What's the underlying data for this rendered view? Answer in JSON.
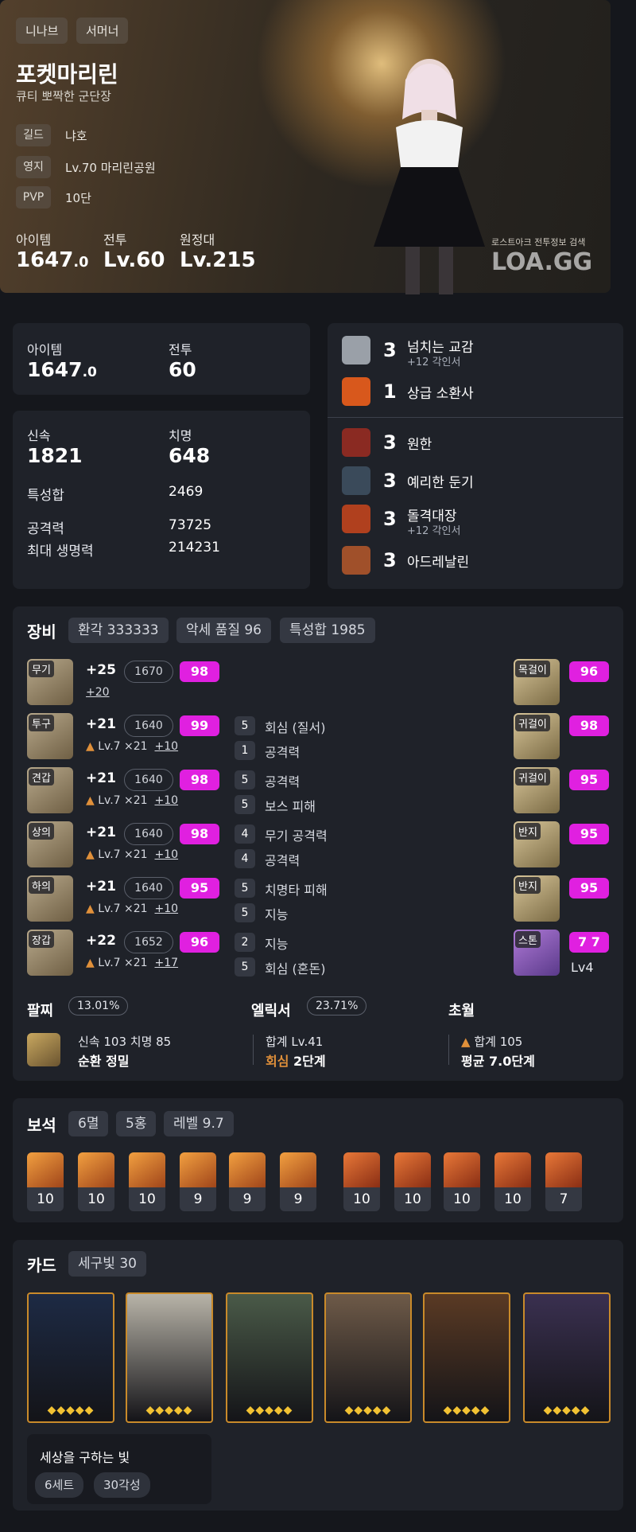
{
  "hero": {
    "server": "니나브",
    "class": "서머너",
    "name": "포켓마리린",
    "title": "큐티 뽀짝한 군단장",
    "rows": [
      {
        "label": "길드",
        "value": "냐호"
      },
      {
        "label": "영지",
        "value": "Lv.70 마리린공원"
      },
      {
        "label": "PVP",
        "value": "10단"
      }
    ],
    "stats": [
      {
        "label": "아이템",
        "main": "1647",
        "small": ".0"
      },
      {
        "label": "전투",
        "main": "Lv.60",
        "small": ""
      },
      {
        "label": "원정대",
        "main": "Lv.215",
        "small": ""
      }
    ],
    "watermark_small": "로스트아크 전투정보 검색",
    "watermark_big": "LOA.GG"
  },
  "summary": {
    "item_label": "아이템",
    "item_main": "1647",
    "item_small": ".0",
    "combat_label": "전투",
    "combat_value": "60"
  },
  "stats": {
    "speed_label": "신속",
    "speed_value": "1821",
    "crit_label": "치명",
    "crit_value": "648",
    "total_label": "특성합",
    "total_value": "2469",
    "atk_label": "공격력",
    "atk_value": "73725",
    "hp_label": "최대 생명력",
    "hp_value": "214231"
  },
  "engravings_top": [
    {
      "level": "3",
      "name": "넘치는 교감",
      "sub": "+12 각인서",
      "icon_color": "#9aa0a8"
    },
    {
      "level": "1",
      "name": "상급 소환사",
      "sub": "",
      "icon_color": "#d8581c"
    }
  ],
  "engravings_bottom": [
    {
      "level": "3",
      "name": "원한",
      "sub": "",
      "icon_color": "#8a2a22"
    },
    {
      "level": "3",
      "name": "예리한 둔기",
      "sub": "",
      "icon_color": "#3a4a5a"
    },
    {
      "level": "3",
      "name": "돌격대장",
      "sub": "+12 각인서",
      "icon_color": "#b0401e"
    },
    {
      "level": "3",
      "name": "아드레날린",
      "sub": "",
      "icon_color": "#a0502a"
    }
  ],
  "equipment": {
    "title": "장비",
    "pills": [
      "환각 333333",
      "악세 품질 96",
      "특성합 1985"
    ],
    "gear": [
      {
        "tag": "무기",
        "plus": "+25",
        "level": "1670",
        "quality": "98",
        "sub_plain": "",
        "sub_link": "+20",
        "opts": []
      },
      {
        "tag": "투구",
        "plus": "+21",
        "level": "1640",
        "quality": "99",
        "sub_plain": "Lv.7 ×21",
        "sub_link": "+10",
        "opts": [
          {
            "n": "5",
            "t": "회심 (질서)"
          },
          {
            "n": "1",
            "t": "공격력"
          }
        ]
      },
      {
        "tag": "견갑",
        "plus": "+21",
        "level": "1640",
        "quality": "98",
        "sub_plain": "Lv.7 ×21",
        "sub_link": "+10",
        "opts": [
          {
            "n": "5",
            "t": "공격력"
          },
          {
            "n": "5",
            "t": "보스 피해"
          }
        ]
      },
      {
        "tag": "상의",
        "plus": "+21",
        "level": "1640",
        "quality": "98",
        "sub_plain": "Lv.7 ×21",
        "sub_link": "+10",
        "opts": [
          {
            "n": "4",
            "t": "무기 공격력"
          },
          {
            "n": "4",
            "t": "공격력"
          }
        ]
      },
      {
        "tag": "하의",
        "plus": "+21",
        "level": "1640",
        "quality": "95",
        "sub_plain": "Lv.7 ×21",
        "sub_link": "+10",
        "opts": [
          {
            "n": "5",
            "t": "치명타 피해"
          },
          {
            "n": "5",
            "t": "지능"
          }
        ]
      },
      {
        "tag": "장갑",
        "plus": "+22",
        "level": "1652",
        "quality": "96",
        "sub_plain": "Lv.7 ×21",
        "sub_link": "+17",
        "opts": [
          {
            "n": "2",
            "t": "지능"
          },
          {
            "n": "5",
            "t": "회심 (혼돈)"
          }
        ]
      }
    ],
    "accessories": [
      {
        "tag": "목걸이",
        "quality": "96"
      },
      {
        "tag": "귀걸이",
        "quality": "98"
      },
      {
        "tag": "귀걸이",
        "quality": "95"
      },
      {
        "tag": "반지",
        "quality": "95"
      },
      {
        "tag": "반지",
        "quality": "95"
      },
      {
        "tag": "스톤",
        "quality": "7 7",
        "sub": "Lv4"
      }
    ],
    "bracelet": {
      "title": "팔찌",
      "pct": "13.01%",
      "line1": "신속 103   치명 85",
      "line2": "순환   정밀"
    },
    "elixir": {
      "title": "엘릭서",
      "pct": "23.71%",
      "line1": "합계 Lv.41",
      "line2_a": "회심",
      "line2_b": "2단계"
    },
    "transcend": {
      "title": "초월",
      "line1": "합계 105",
      "line2": "평균 7.0단계"
    }
  },
  "gems": {
    "title": "보석",
    "pills": [
      "6멸",
      "5홍",
      "레벨 9.7"
    ],
    "items": [
      {
        "type": "a",
        "level": "10"
      },
      {
        "type": "a",
        "level": "10"
      },
      {
        "type": "a",
        "level": "10"
      },
      {
        "type": "a",
        "level": "9"
      },
      {
        "type": "a",
        "level": "9"
      },
      {
        "type": "a",
        "level": "9"
      },
      {
        "type": "b",
        "level": "10"
      },
      {
        "type": "b",
        "level": "10"
      },
      {
        "type": "b",
        "level": "10"
      },
      {
        "type": "b",
        "level": "10"
      },
      {
        "type": "b",
        "level": "7"
      }
    ]
  },
  "cards": {
    "title": "카드",
    "pill": "세구빛 30",
    "set_name": "세상을 구하는 빛",
    "set_pills": [
      "6세트",
      "30각성"
    ],
    "colors": [
      "#1d2a44",
      "#b8b4a8",
      "#4a5a48",
      "#6e5a48",
      "#5a3a24",
      "#3a3050"
    ]
  },
  "colors": {
    "quality": "#e020e0",
    "accent_fire": "#e0903a"
  }
}
